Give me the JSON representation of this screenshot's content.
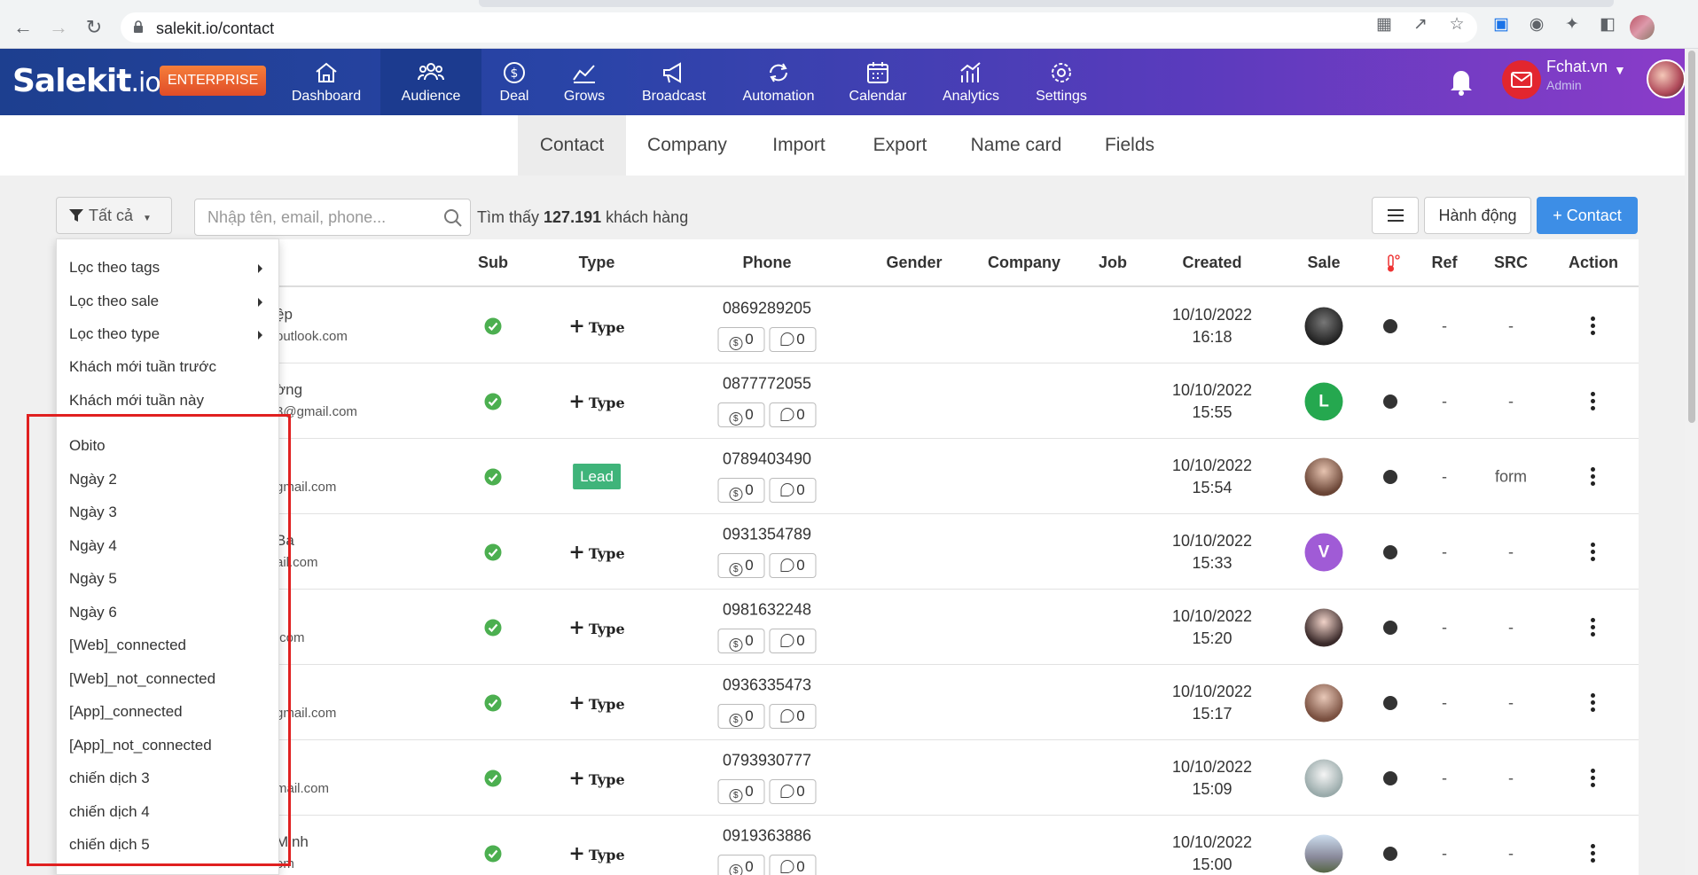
{
  "browser": {
    "url": "salekit.io/contact"
  },
  "app": {
    "logo_main": "Salekit",
    "logo_suffix": ".io",
    "plan_badge": "ENTERPRISE",
    "nav": [
      {
        "label": "Dashboard",
        "icon": "home-icon"
      },
      {
        "label": "Audience",
        "icon": "users-icon",
        "active": true
      },
      {
        "label": "Deal",
        "icon": "dollar-icon"
      },
      {
        "label": "Grows",
        "icon": "growth-chart-icon"
      },
      {
        "label": "Broadcast",
        "icon": "megaphone-icon"
      },
      {
        "label": "Automation",
        "icon": "refresh-cycle-icon"
      },
      {
        "label": "Calendar",
        "icon": "calendar-icon"
      },
      {
        "label": "Analytics",
        "icon": "analytics-icon"
      },
      {
        "label": "Settings",
        "icon": "gear-icon"
      }
    ],
    "user": {
      "name": "Fchat.vn",
      "role": "Admin"
    }
  },
  "subnav": {
    "tabs": [
      "Contact",
      "Company",
      "Import",
      "Export",
      "Name card",
      "Fields"
    ],
    "active": "Contact"
  },
  "toolbar": {
    "filter_label": "Tất cả",
    "search_placeholder": "Nhập tên, email, phone...",
    "found_prefix": "Tìm thấy",
    "found_count": "127.191",
    "found_suffix": "khách hàng",
    "action_label": "Hành động",
    "add_contact_label": "+ Contact"
  },
  "table": {
    "headers": [
      "Sub",
      "Type",
      "Phone",
      "Gender",
      "Company",
      "Job",
      "Created",
      "Sale",
      "Ref",
      "SRC",
      "Action"
    ],
    "rows": [
      {
        "name": "ệp",
        "email": "outlook.com",
        "type": "plus",
        "type_label": "Type",
        "phone": "0869289205",
        "deals": "0",
        "notes": "0",
        "date": "10/10/2022",
        "time": "16:18",
        "sale": "photo",
        "ref": "-",
        "src": "-"
      },
      {
        "name": "ờng",
        "email": "3@gmail.com",
        "type": "plus",
        "type_label": "Type",
        "phone": "0877772055",
        "deals": "0",
        "notes": "0",
        "date": "10/10/2022",
        "time": "15:55",
        "sale": "letter",
        "sale_letter": "L",
        "sale_color": "#25a84f",
        "ref": "-",
        "src": "-"
      },
      {
        "name": "",
        "email": "gmail.com",
        "type": "lead",
        "type_label": "Lead",
        "phone": "0789403490",
        "deals": "0",
        "notes": "0",
        "date": "10/10/2022",
        "time": "15:54",
        "sale": "photo",
        "ref": "-",
        "src": "form"
      },
      {
        "name": "Ba",
        "email": "ail.com",
        "type": "plus",
        "type_label": "Type",
        "phone": "0931354789",
        "deals": "0",
        "notes": "0",
        "date": "10/10/2022",
        "time": "15:33",
        "sale": "letter",
        "sale_letter": "V",
        "sale_color": "#a05bd6",
        "ref": "-",
        "src": "-"
      },
      {
        "name": "",
        "email": ".com",
        "type": "plus",
        "type_label": "Type",
        "phone": "0981632248",
        "deals": "0",
        "notes": "0",
        "date": "10/10/2022",
        "time": "15:20",
        "sale": "photo",
        "ref": "-",
        "src": "-"
      },
      {
        "name": "",
        "email": "gmail.com",
        "type": "plus",
        "type_label": "Type",
        "phone": "0936335473",
        "deals": "0",
        "notes": "0",
        "date": "10/10/2022",
        "time": "15:17",
        "sale": "photo",
        "ref": "-",
        "src": "-"
      },
      {
        "name": "",
        "email": "mail.com",
        "type": "plus",
        "type_label": "Type",
        "phone": "0793930777",
        "deals": "0",
        "notes": "0",
        "date": "10/10/2022",
        "time": "15:09",
        "sale": "photo",
        "ref": "-",
        "src": "-"
      },
      {
        "name": "Minh",
        "email": "om",
        "type": "plus",
        "type_label": "Type",
        "phone": "0919363886",
        "deals": "0",
        "notes": "0",
        "date": "10/10/2022",
        "time": "15:00",
        "sale": "photo",
        "ref": "-",
        "src": "-"
      }
    ]
  },
  "dropdown": {
    "submenus": [
      "Lọc theo tags",
      "Lọc theo sale",
      "Lọc theo type"
    ],
    "quick_filters": [
      "Khách mới tuần trước",
      "Khách mới tuần này"
    ],
    "segments": [
      "Obito",
      "Ngày 2",
      "Ngày 3",
      "Ngày 4",
      "Ngày 5",
      "Ngày 6",
      "[Web]_connected",
      "[Web]_not_connected",
      "[App]_connected",
      "[App]_not_connected",
      "chiến dịch 3",
      "chiến dịch 4",
      "chiến dịch 5"
    ]
  },
  "colors": {
    "header_start": "#1d3f8f",
    "header_end": "#8c3cc9",
    "primary_button": "#3d8ee6",
    "lead_badge": "#3fb47a",
    "sub_check": "#4caf50",
    "highlight_box": "#e02020"
  }
}
